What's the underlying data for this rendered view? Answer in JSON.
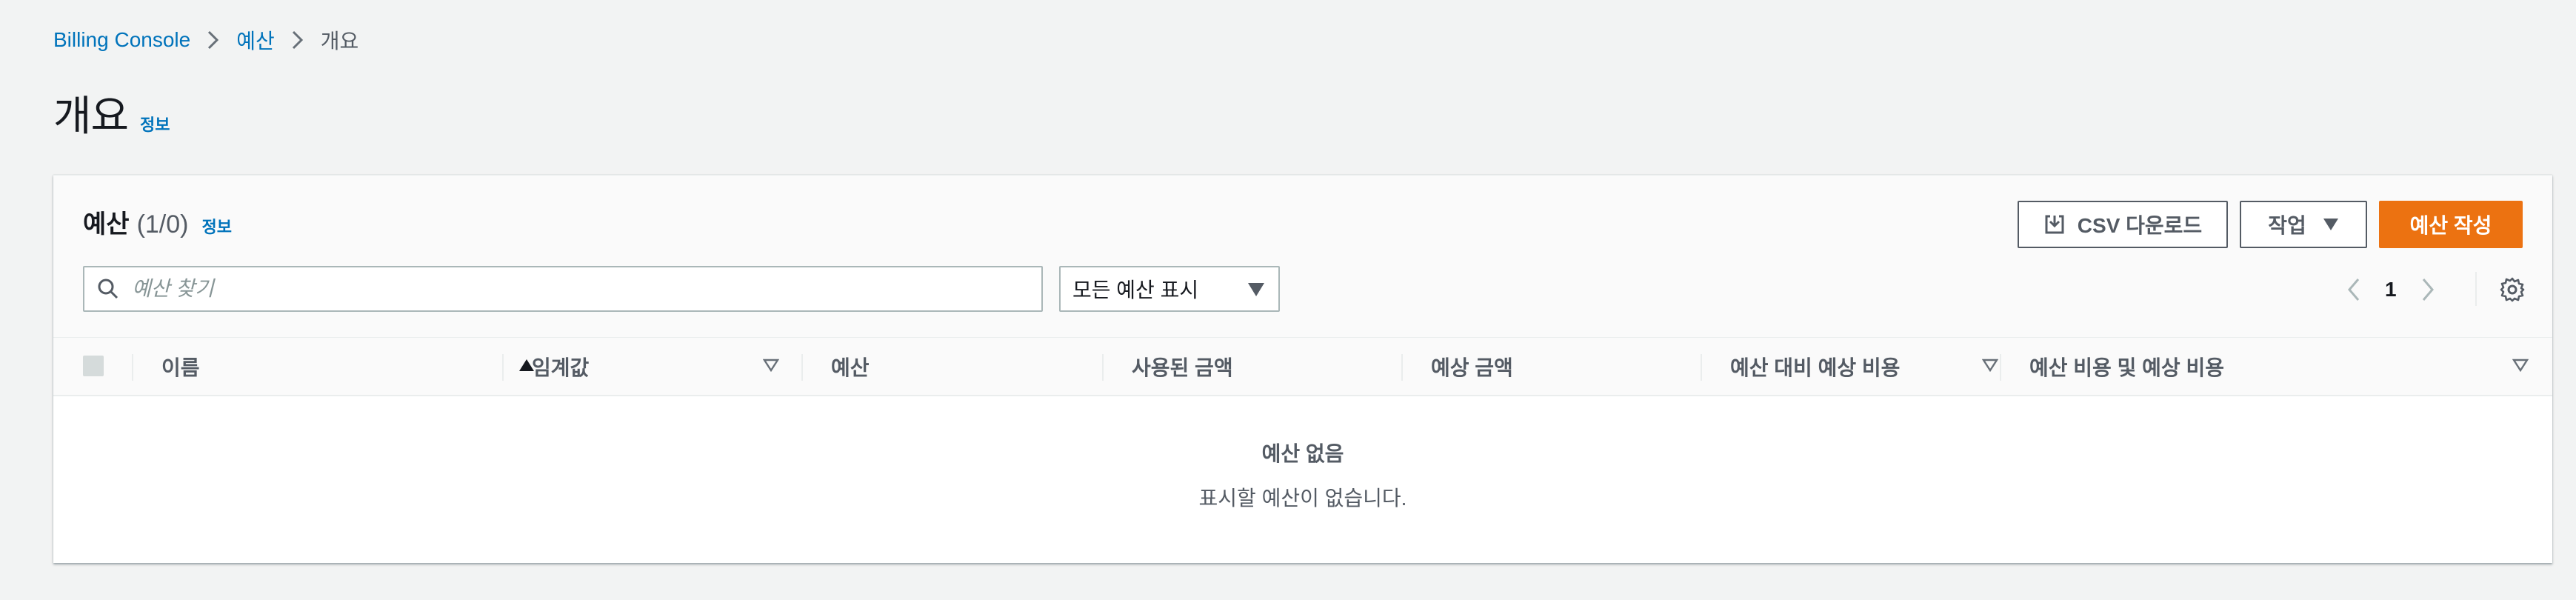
{
  "breadcrumb": {
    "items": [
      {
        "label": "Billing Console"
      },
      {
        "label": "예산"
      },
      {
        "label": "개요"
      }
    ]
  },
  "page": {
    "title": "개요",
    "info_label": "정보"
  },
  "budgets": {
    "title": "예산",
    "count": "(1/0)",
    "info_label": "정보",
    "csv_button": "CSV 다운로드",
    "actions_button": "작업",
    "create_button": "예산 작성",
    "search_placeholder": "예산 찾기",
    "filter_value": "모든 예산 표시",
    "page_number": "1",
    "columns": [
      {
        "label": "이름",
        "sort": "ascending"
      },
      {
        "label": "임계값",
        "sort": "sortable"
      },
      {
        "label": "예산",
        "sort": "none"
      },
      {
        "label": "사용된 금액",
        "sort": "none"
      },
      {
        "label": "예상 금액",
        "sort": "none"
      },
      {
        "label": "예산 대비 예상 비용",
        "sort": "sortable"
      },
      {
        "label": "예산 비용 및 예상 비용",
        "sort": "sortable"
      }
    ],
    "empty_title": "예산 없음",
    "empty_description": "표시할 예산이 없습니다."
  },
  "colors": {
    "link": "#0073bb",
    "primary_button": "#ec7211",
    "page_background": "#f2f3f3",
    "text": "#16191f",
    "muted_text": "#545b64"
  },
  "icons": {
    "breadcrumb_separator": "chevron-right-icon",
    "csv": "download-icon",
    "actions": "caret-down-icon",
    "search": "search-icon",
    "pager_prev": "chevron-left-icon",
    "pager_next": "chevron-right-icon",
    "settings": "gear-icon"
  }
}
